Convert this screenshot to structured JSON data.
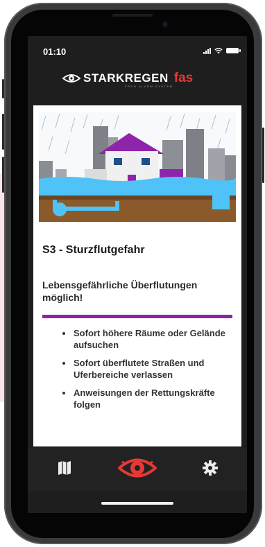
{
  "status_bar": {
    "time": "01:10"
  },
  "app": {
    "logo_text": "STARKREGEN",
    "logo_brand": "fas",
    "logo_subtitle": "FRÜH·ALARM·SYSTEM"
  },
  "warning": {
    "level_title": "S3 - Sturzflutgefahr",
    "description": "Lebensgefährliche Überflutungen möglich!",
    "accent_color": "#8e24aa",
    "instructions": [
      "Sofort höhere Räume oder Gelände aufsuchen",
      "Sofort überflutete Straßen und Uferbereiche verlassen",
      "Anweisungen der Rettungskräfte folgen"
    ]
  },
  "tab_bar": {
    "tabs": [
      {
        "icon": "map-icon",
        "active": false
      },
      {
        "icon": "eye-icon",
        "active": true,
        "color": "#e53935"
      },
      {
        "icon": "gear-icon",
        "active": false
      }
    ]
  }
}
